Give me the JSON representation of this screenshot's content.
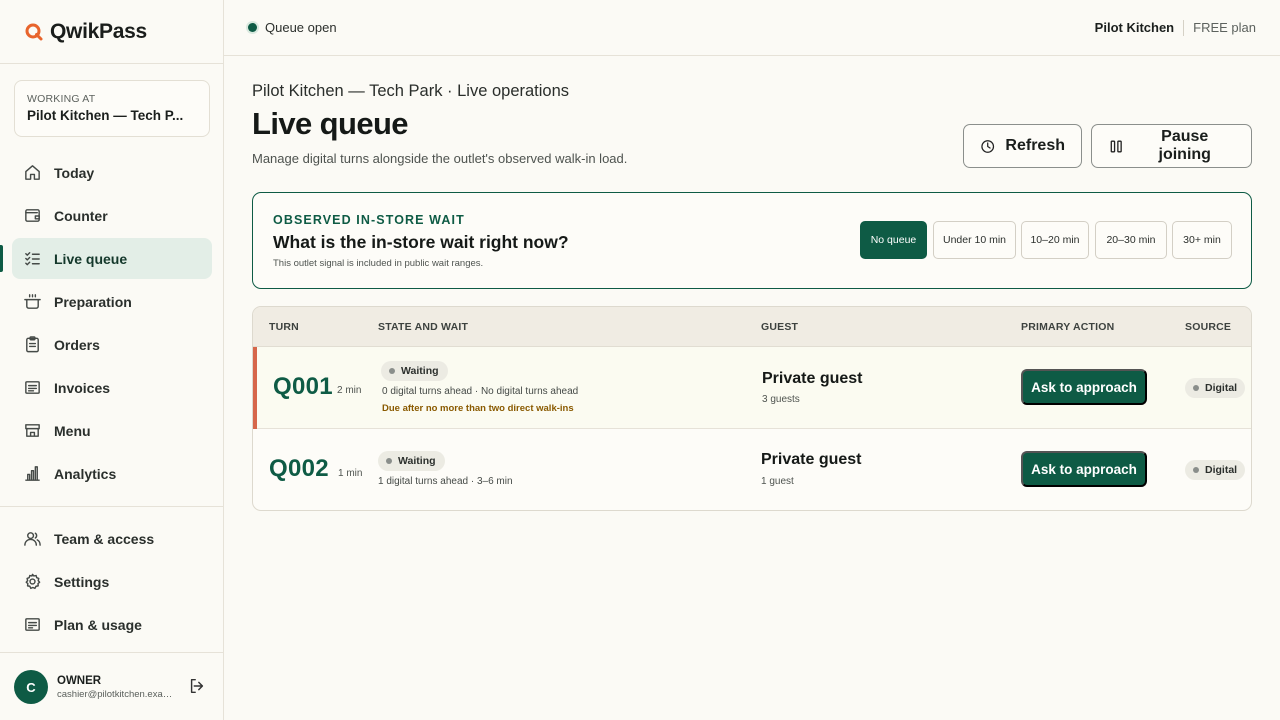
{
  "brand": {
    "name": "QwikPass",
    "accent": "#e8642c"
  },
  "workplace": {
    "label": "WORKING AT",
    "name": "Pilot Kitchen — Tech P..."
  },
  "nav": [
    {
      "label": "Today",
      "icon": "home-icon"
    },
    {
      "label": "Counter",
      "icon": "wallet-icon"
    },
    {
      "label": "Live queue",
      "icon": "list-check-icon",
      "active": true
    },
    {
      "label": "Preparation",
      "icon": "pot-icon"
    },
    {
      "label": "Orders",
      "icon": "clipboard-icon"
    },
    {
      "label": "Invoices",
      "icon": "receipt-icon"
    },
    {
      "label": "Menu",
      "icon": "store-icon"
    },
    {
      "label": "Analytics",
      "icon": "bar-chart-icon"
    }
  ],
  "nav_secondary": [
    {
      "label": "Team & access",
      "icon": "users-icon"
    },
    {
      "label": "Settings",
      "icon": "gear-icon"
    },
    {
      "label": "Plan & usage",
      "icon": "document-icon"
    }
  ],
  "user": {
    "initial": "C",
    "role": "OWNER",
    "email": "cashier@pilotkitchen.exam..."
  },
  "topbar": {
    "status": "Queue open",
    "outlet": "Pilot Kitchen",
    "plan": "FREE plan"
  },
  "page": {
    "breadcrumb": "Pilot Kitchen — Tech Park · Live operations",
    "title": "Live queue",
    "subtitle": "Manage digital turns alongside the outlet's observed walk-in load.",
    "refresh_label": "Refresh",
    "pause_label": "Pause joining"
  },
  "wait_signal": {
    "eyebrow": "OBSERVED IN-STORE WAIT",
    "question": "What is the in-store wait right now?",
    "note": "This outlet signal is included in public wait ranges.",
    "options": [
      "No queue",
      "Under 10 min",
      "10–20 min",
      "20–30 min",
      "30+ min"
    ],
    "selected": "No queue"
  },
  "table": {
    "headers": [
      "TURN",
      "STATE AND WAIT",
      "GUEST",
      "PRIMARY ACTION",
      "SOURCE"
    ],
    "rows": [
      {
        "turn": "Q001",
        "age": "2 min",
        "state": "Waiting",
        "ahead": "0 digital turns ahead · No digital turns ahead",
        "due": "Due after no more than two direct walk-ins",
        "guest": "Private guest",
        "guest_count": "3 guests",
        "action": "Ask to approach",
        "source": "Digital"
      },
      {
        "turn": "Q002",
        "age": "1 min",
        "state": "Waiting",
        "ahead": "1 digital turns ahead · 3–6 min",
        "due": "",
        "guest": "Private guest",
        "guest_count": "1 guest",
        "action": "Ask to approach",
        "source": "Digital"
      }
    ]
  },
  "colors": {
    "primary": "#0e5b45",
    "highlight_bar": "#d6664a",
    "background": "#fbfaf5"
  }
}
